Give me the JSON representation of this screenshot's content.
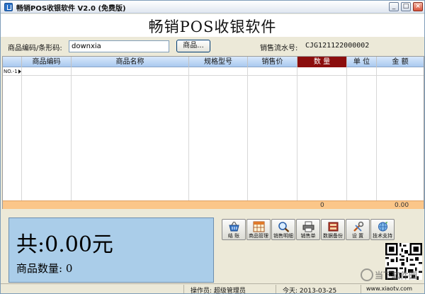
{
  "window": {
    "title": "畅销POS收银软件 V2.0 (免费版)",
    "controls": {
      "minimize": "_",
      "maximize": "□",
      "close": "×"
    }
  },
  "header": {
    "title": "畅销POS收银软件"
  },
  "scan": {
    "label": "商品编码/条形码:",
    "value": "downxia",
    "goods_button": "商品...",
    "serial_label": "销售流水号:",
    "serial_value": "CJG121122000002"
  },
  "grid": {
    "columns": [
      "商品编码",
      "商品名称",
      "规格型号",
      "销售价",
      "数 量",
      "单 位",
      "金 额"
    ],
    "highlight_column": "数 量",
    "row_header": "NO.-1",
    "footer": {
      "quantity_total": "0",
      "amount_total": "0.00"
    }
  },
  "total": {
    "amount": "共:0.00元",
    "qty_label": "商品数量:",
    "qty_value": "0"
  },
  "toolbar": {
    "items": [
      {
        "label": "结 账",
        "icon": "checkout-basket-icon"
      },
      {
        "label": "商品管理",
        "icon": "goods-grid-icon"
      },
      {
        "label": "销售明细",
        "icon": "magnifier-icon"
      },
      {
        "label": "销售单",
        "icon": "printer-icon"
      },
      {
        "label": "数据备份",
        "icon": "database-backup-icon"
      },
      {
        "label": "设 置",
        "icon": "settings-tools-icon"
      },
      {
        "label": "技术支持",
        "icon": "support-globe-icon"
      }
    ]
  },
  "watermark": {
    "text": "当下软件园"
  },
  "status": {
    "operator": "操作员: 超级管理员",
    "date": "今天: 2013-03-25",
    "url": "www.xiaotv.com"
  },
  "colors": {
    "header_bg": "#a9c9ef",
    "highlight_col": "#8b0d0d",
    "footer_row": "#fbc689",
    "total_panel": "#aacde9"
  }
}
